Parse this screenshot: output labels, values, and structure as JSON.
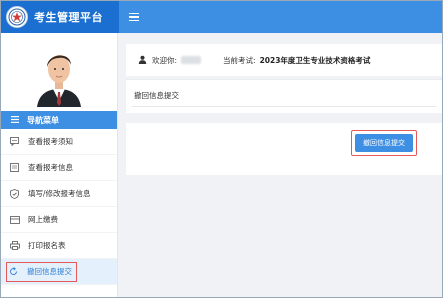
{
  "app": {
    "title": "考生管理平台"
  },
  "sidebar": {
    "nav_header": "导航菜单",
    "items": [
      {
        "label": "查看报考须知",
        "icon": "message-icon"
      },
      {
        "label": "查看报考信息",
        "icon": "document-icon"
      },
      {
        "label": "填写/修改报考信息",
        "icon": "shield-check-icon"
      },
      {
        "label": "网上缴费",
        "icon": "payment-icon"
      },
      {
        "label": "打印报名表",
        "icon": "printer-icon"
      },
      {
        "label": "撤回信息提交",
        "icon": "undo-icon",
        "active": true
      }
    ]
  },
  "header": {
    "welcome_label": "欢迎你:",
    "current_exam_label": "当前考试:",
    "current_exam_name": "2023年度卫生专业技术资格考试"
  },
  "card": {
    "title": "撤回信息提交"
  },
  "actions": {
    "submit_label": "撤回信息提交"
  },
  "colors": {
    "primary": "#3d8fe3",
    "brand_dark": "#1b6fd0",
    "highlight": "#e45a5a"
  }
}
